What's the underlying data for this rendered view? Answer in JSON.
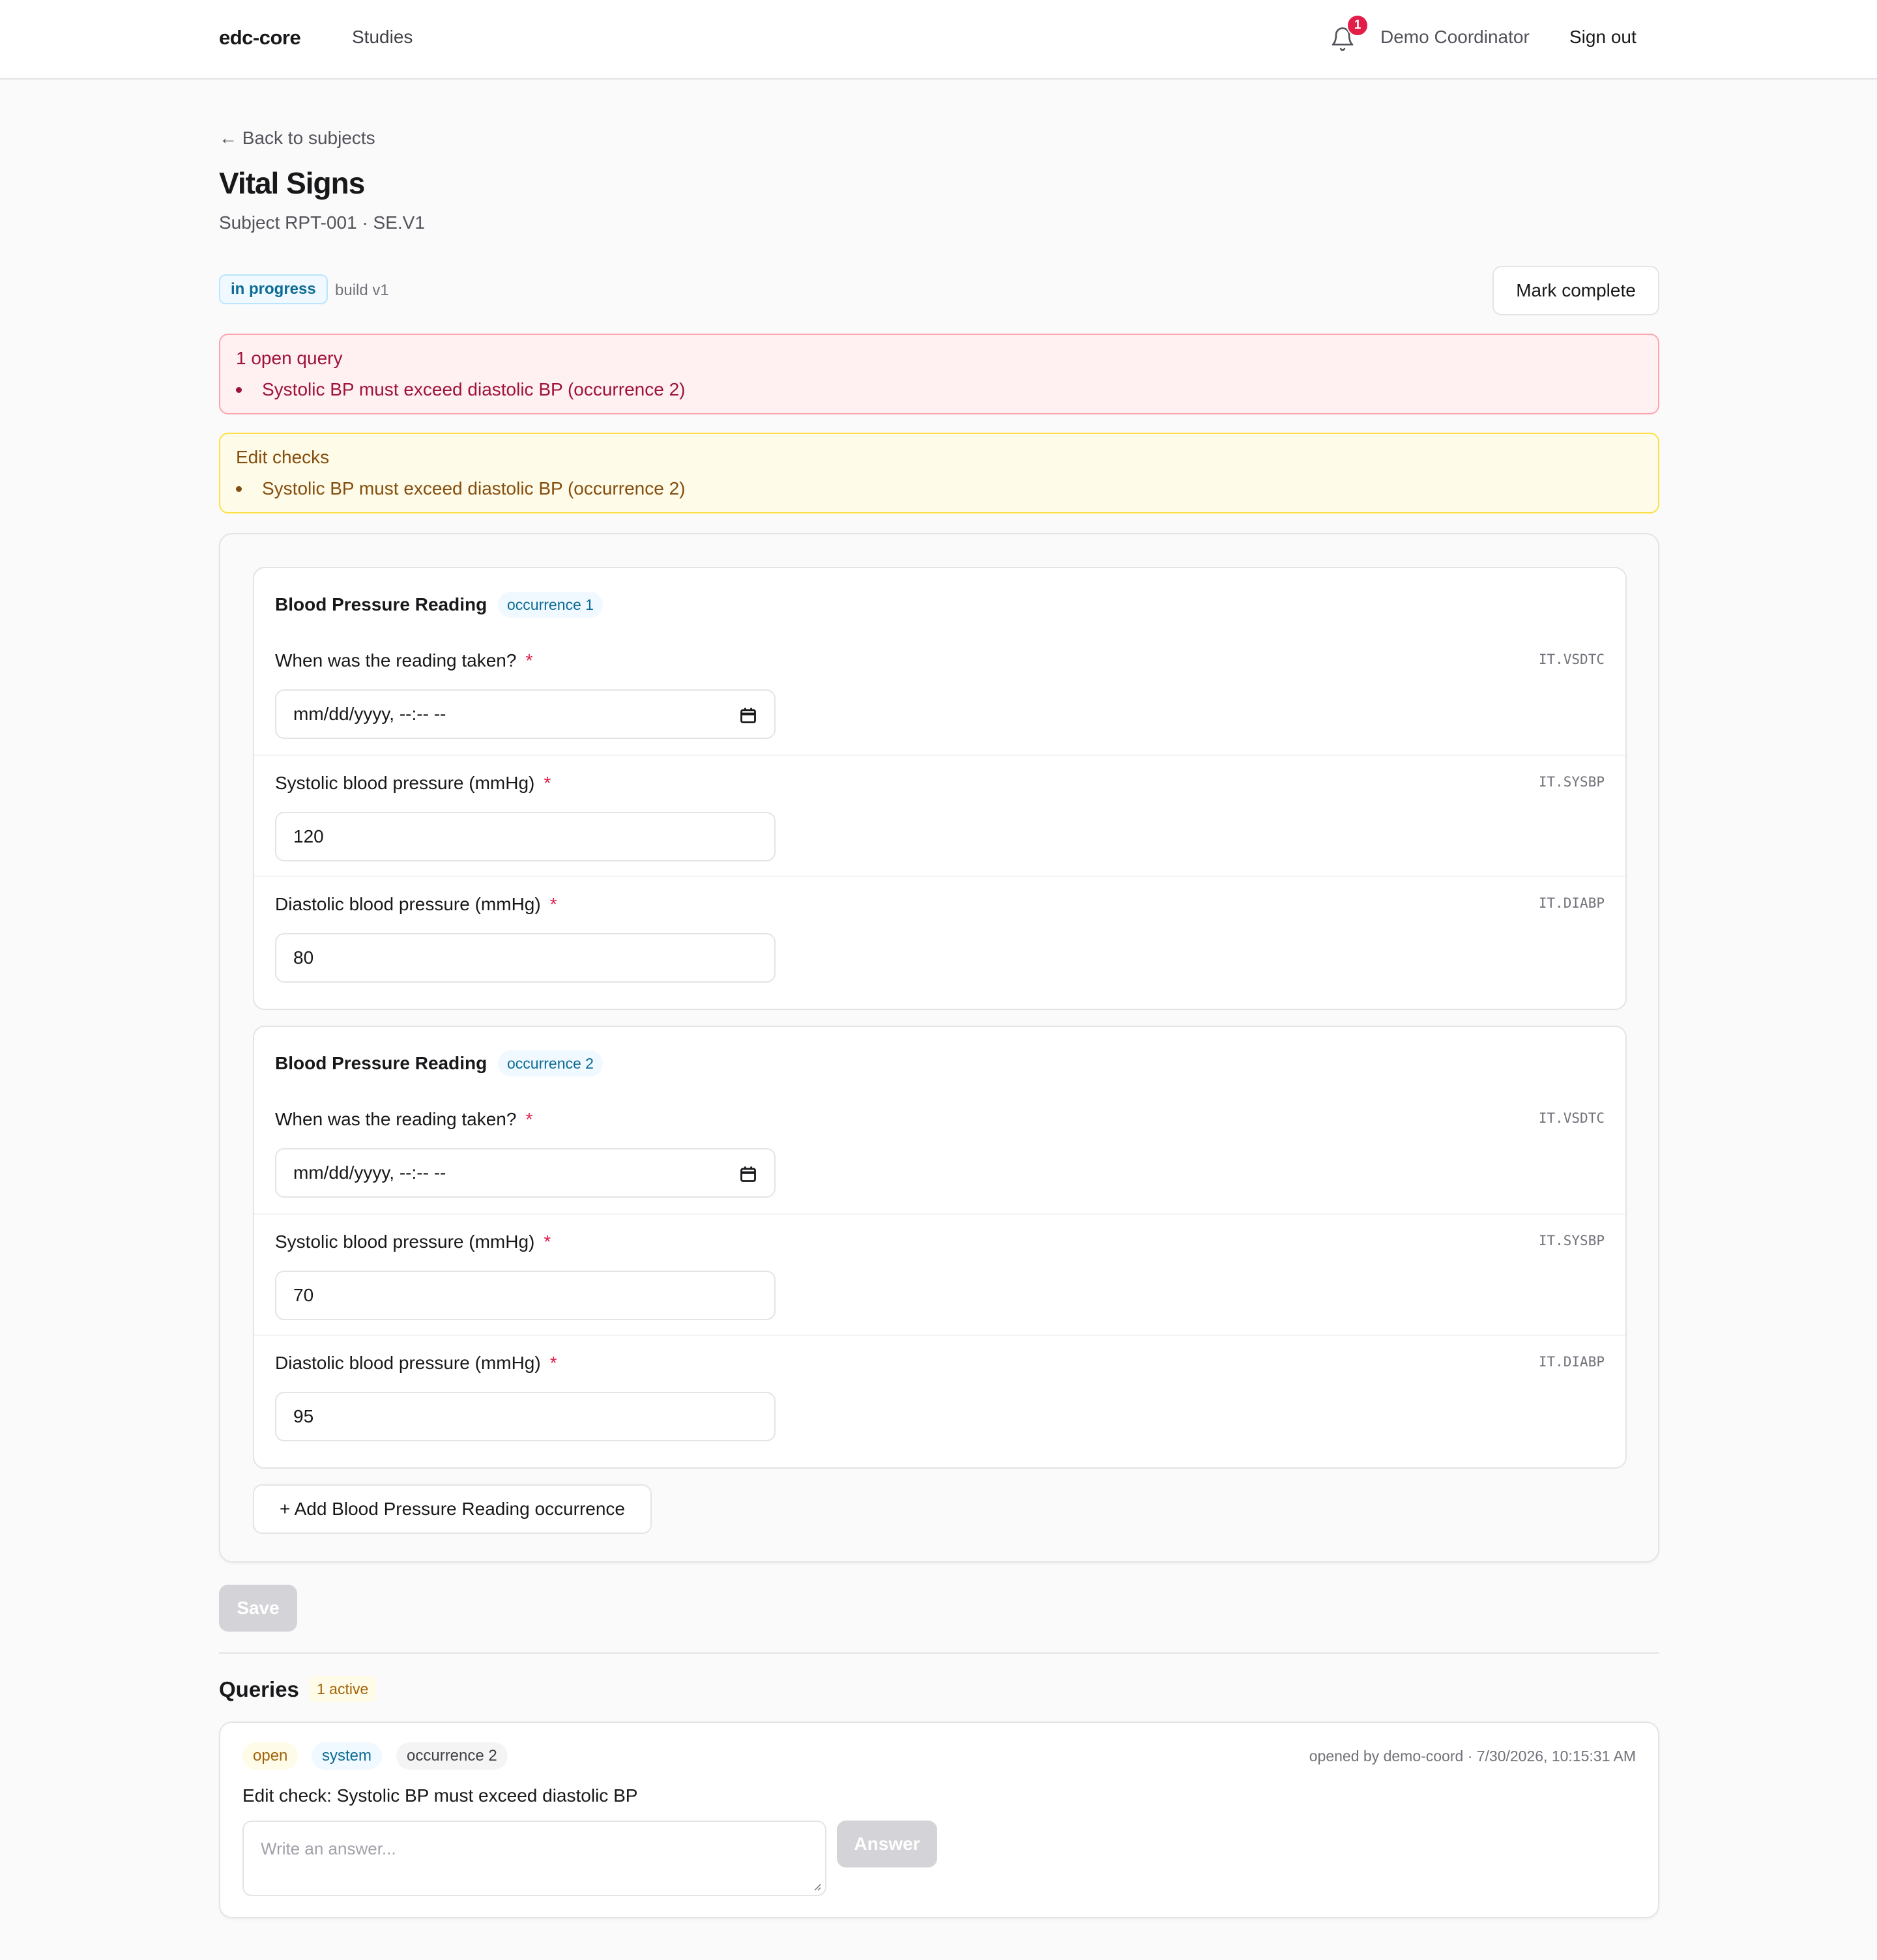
{
  "header": {
    "brand": "edc-core",
    "nav_studies": "Studies",
    "notification_count": "1",
    "user_name": "Demo Coordinator",
    "sign_out": "Sign out"
  },
  "page": {
    "back_link": "← Back to subjects",
    "title": "Vital Signs",
    "subtitle": "Subject RPT-001 · SE.V1",
    "status_badge": "in progress",
    "build": "build v1",
    "mark_complete": "Mark complete"
  },
  "alerts": {
    "query_title": "1 open query",
    "query_item": "Systolic BP must exceed diastolic BP (occurrence 2)",
    "edit_title": "Edit checks",
    "edit_item": "Systolic BP must exceed diastolic BP (occurrence 2)"
  },
  "groups": [
    {
      "title": "Blood Pressure Reading",
      "occurrence": "occurrence 1",
      "fields": [
        {
          "label": "When was the reading taken?",
          "required": "*",
          "code": "IT.VSDTC",
          "value": "mm/dd/yyyy, --:-- --"
        },
        {
          "label": "Systolic blood pressure (mmHg)",
          "required": "*",
          "code": "IT.SYSBP",
          "value": "120"
        },
        {
          "label": "Diastolic blood pressure (mmHg)",
          "required": "*",
          "code": "IT.DIABP",
          "value": "80"
        }
      ]
    },
    {
      "title": "Blood Pressure Reading",
      "occurrence": "occurrence 2",
      "fields": [
        {
          "label": "When was the reading taken?",
          "required": "*",
          "code": "IT.VSDTC",
          "value": "mm/dd/yyyy, --:-- --"
        },
        {
          "label": "Systolic blood pressure (mmHg)",
          "required": "*",
          "code": "IT.SYSBP",
          "value": "70"
        },
        {
          "label": "Diastolic blood pressure (mmHg)",
          "required": "*",
          "code": "IT.DIABP",
          "value": "95"
        }
      ]
    }
  ],
  "form": {
    "add_occurrence": "+ Add Blood Pressure Reading occurrence",
    "save": "Save"
  },
  "queries": {
    "title": "Queries",
    "active_badge": "1 active",
    "items": [
      {
        "status": "open",
        "source": "system",
        "occurrence": "occurrence 2",
        "meta": "opened by demo-coord · 7/30/2026, 10:15:31 AM",
        "text": "Edit check: Systolic BP must exceed diastolic BP",
        "answer_placeholder": "Write an answer...",
        "answer_button": "Answer"
      }
    ]
  },
  "colors": {
    "accent_sky": "#0c6b94",
    "error_rose": "#9f1239",
    "warning_amber": "#854d0e",
    "required": "#e11d48"
  }
}
